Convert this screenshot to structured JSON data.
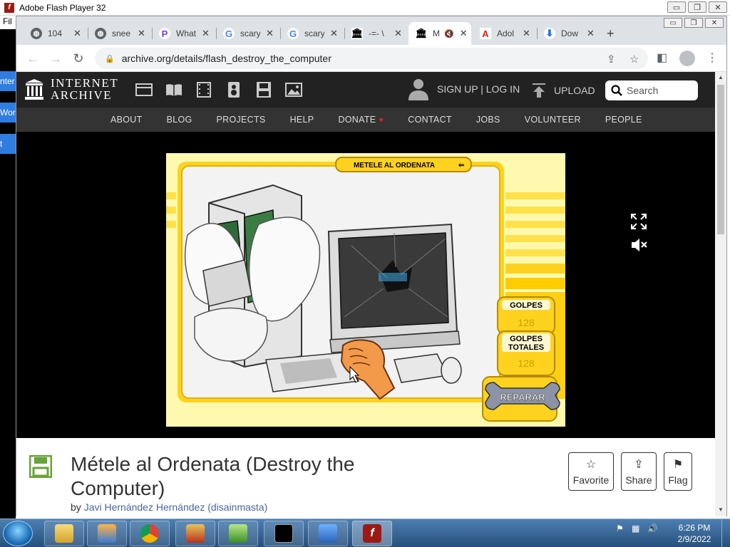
{
  "flash_window": {
    "title": "Adobe Flash Player 32",
    "menu": "Fil",
    "controls": [
      "▭",
      "❐",
      "✕"
    ]
  },
  "left_tabs": [
    "nter",
    "Wor",
    "t"
  ],
  "browser": {
    "tabs": [
      {
        "label": "104",
        "favicon": "globe-icon"
      },
      {
        "label": "snee",
        "favicon": "globe-icon"
      },
      {
        "label": "What",
        "favicon": "p-icon"
      },
      {
        "label": "scary",
        "favicon": "google-icon"
      },
      {
        "label": "scary",
        "favicon": "google-icon"
      },
      {
        "label": "-=- \\",
        "favicon": "archive-icon"
      },
      {
        "label": "M",
        "favicon": "archive-icon",
        "active": true
      },
      {
        "label": "Adol",
        "favicon": "adobe-icon"
      },
      {
        "label": "Dow",
        "favicon": "download-icon"
      }
    ],
    "url": "archive.org/details/flash_destroy_the_computer"
  },
  "ia": {
    "logo_line1": "INTERNET",
    "logo_line2": "ARCHIVE",
    "signup": "SIGN UP | LOG IN",
    "upload": "UPLOAD",
    "search_placeholder": "Search",
    "nav": [
      "ABOUT",
      "BLOG",
      "PROJECTS",
      "HELP",
      "DONATE",
      "CONTACT",
      "JOBS",
      "VOLUNTEER",
      "PEOPLE"
    ]
  },
  "game": {
    "banner": "METELE AL ORDENATA",
    "golpes_label": "GOLPES",
    "golpes_value": "128",
    "golpes_totales_label_1": "GOLPES",
    "golpes_totales_label_2": "TOTALES",
    "golpes_totales_value": "128",
    "reparar": "REPARAR"
  },
  "item": {
    "title": "Métele al Ordenata (Destroy the Computer)",
    "by": "by",
    "author": "Javi Hernández Hernández (disainmasta)",
    "actions": [
      {
        "label": "Favorite",
        "icon": "star-icon"
      },
      {
        "label": "Share",
        "icon": "share-icon"
      },
      {
        "label": "Flag",
        "icon": "flag-icon"
      }
    ]
  },
  "taskbar": {
    "time": "6:26 PM",
    "date": "2/9/2022"
  }
}
